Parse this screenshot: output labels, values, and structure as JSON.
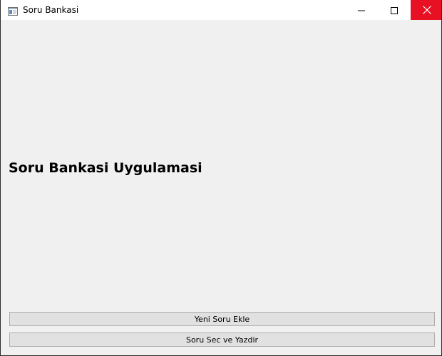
{
  "window": {
    "title": "Soru Bankasi"
  },
  "main": {
    "heading": "Soru Bankasi Uygulamasi"
  },
  "buttons": {
    "add_question": "Yeni Soru Ekle",
    "select_print": "Soru Sec ve Yazdir"
  },
  "colors": {
    "close_hover": "#e81123",
    "client_background": "#f0f0f0",
    "button_background": "#e1e1e1",
    "button_border": "#adadad"
  },
  "icons": {
    "app": "window-app-icon",
    "minimize": "minimize-icon",
    "maximize": "maximize-icon",
    "close": "close-icon"
  }
}
